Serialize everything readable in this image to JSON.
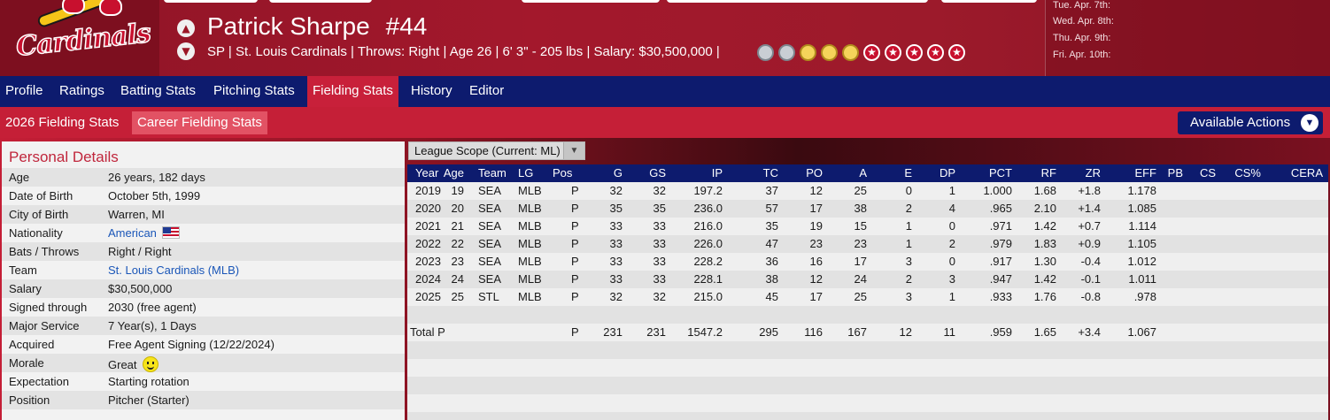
{
  "header": {
    "team_logo_text": "Cardinals",
    "player_name": "Patrick Sharpe",
    "player_number": "#44",
    "player_info": "SP | St. Louis Cardinals  |  Throws: Right  |  Age 26  |  6' 3\" - 205 lbs  |  Salary: $30,500,000  |",
    "badges": [
      "gray",
      "gray",
      "gold",
      "gold",
      "gold",
      "star",
      "star",
      "star",
      "star",
      "star"
    ],
    "prev_icon": "chevron-up-icon",
    "next_icon": "chevron-down-icon"
  },
  "schedule": [
    "Tue. Apr. 7th:",
    "Wed. Apr. 8th:",
    "Thu. Apr. 9th:",
    "Fri. Apr. 10th:"
  ],
  "nav": {
    "items": [
      "Profile",
      "Ratings",
      "Batting Stats",
      "Pitching Stats",
      "Fielding Stats",
      "History",
      "Editor"
    ],
    "active": "Fielding Stats"
  },
  "subnav": {
    "items": [
      "2026 Fielding Stats",
      "Career Fielding Stats"
    ],
    "active": "Career Fielding Stats",
    "actions_label": "Available Actions"
  },
  "personal": {
    "title": "Personal Details",
    "rows": [
      {
        "label": "Age",
        "value": "26 years, 182 days"
      },
      {
        "label": "Date of Birth",
        "value": "October 5th, 1999"
      },
      {
        "label": "City of Birth",
        "value": "Warren, MI"
      },
      {
        "label": "Nationality",
        "value": "American"
      },
      {
        "label": "Bats / Throws",
        "value": "Right / Right"
      },
      {
        "label": "Team",
        "value": "St. Louis Cardinals (MLB)"
      },
      {
        "label": "Salary",
        "value": "$30,500,000"
      },
      {
        "label": "Signed through",
        "value": "2030 (free agent)"
      },
      {
        "label": "Major Service",
        "value": "7 Year(s), 1 Days"
      },
      {
        "label": "Acquired",
        "value": "Free Agent Signing (12/22/2024)"
      },
      {
        "label": "Morale",
        "value": "Great"
      },
      {
        "label": "Expectation",
        "value": "Starting rotation"
      },
      {
        "label": "Position",
        "value": "Pitcher (Starter)"
      }
    ]
  },
  "scope": {
    "label": "League Scope  (Current: ML)"
  },
  "stats": {
    "columns": [
      "Year",
      "Age",
      "Team",
      "LG",
      "Pos",
      "G",
      "GS",
      "IP",
      "TC",
      "PO",
      "A",
      "E",
      "DP",
      "PCT",
      "RF",
      "ZR",
      "EFF",
      "PB",
      "CS",
      "CS%",
      "CERA"
    ],
    "rows": [
      [
        "2019",
        "19",
        "SEA",
        "MLB",
        "P",
        "32",
        "32",
        "197.2",
        "37",
        "12",
        "25",
        "0",
        "1",
        "1.000",
        "1.68",
        "+1.8",
        "1.178",
        "",
        "",
        "",
        ""
      ],
      [
        "2020",
        "20",
        "SEA",
        "MLB",
        "P",
        "35",
        "35",
        "236.0",
        "57",
        "17",
        "38",
        "2",
        "4",
        ".965",
        "2.10",
        "+1.4",
        "1.085",
        "",
        "",
        "",
        ""
      ],
      [
        "2021",
        "21",
        "SEA",
        "MLB",
        "P",
        "33",
        "33",
        "216.0",
        "35",
        "19",
        "15",
        "1",
        "0",
        ".971",
        "1.42",
        "+0.7",
        "1.114",
        "",
        "",
        "",
        ""
      ],
      [
        "2022",
        "22",
        "SEA",
        "MLB",
        "P",
        "33",
        "33",
        "226.0",
        "47",
        "23",
        "23",
        "1",
        "2",
        ".979",
        "1.83",
        "+0.9",
        "1.105",
        "",
        "",
        "",
        ""
      ],
      [
        "2023",
        "23",
        "SEA",
        "MLB",
        "P",
        "33",
        "33",
        "228.2",
        "36",
        "16",
        "17",
        "3",
        "0",
        ".917",
        "1.30",
        "-0.4",
        "1.012",
        "",
        "",
        "",
        ""
      ],
      [
        "2024",
        "24",
        "SEA",
        "MLB",
        "P",
        "33",
        "33",
        "228.1",
        "38",
        "12",
        "24",
        "2",
        "3",
        ".947",
        "1.42",
        "-0.1",
        "1.011",
        "",
        "",
        "",
        ""
      ],
      [
        "2025",
        "25",
        "STL",
        "MLB",
        "P",
        "32",
        "32",
        "215.0",
        "45",
        "17",
        "25",
        "3",
        "1",
        ".933",
        "1.76",
        "-0.8",
        ".978",
        "",
        "",
        "",
        ""
      ]
    ],
    "total": {
      "label": "Total P",
      "pos": "P",
      "values": [
        "231",
        "231",
        "1547.2",
        "295",
        "116",
        "167",
        "12",
        "11",
        ".959",
        "1.65",
        "+3.4",
        "1.067"
      ]
    }
  },
  "colors": {
    "navy": "#0d1b6e",
    "cardinal_red": "#c51f37",
    "active_tab": "#c8203a",
    "link": "#1a56b8"
  }
}
